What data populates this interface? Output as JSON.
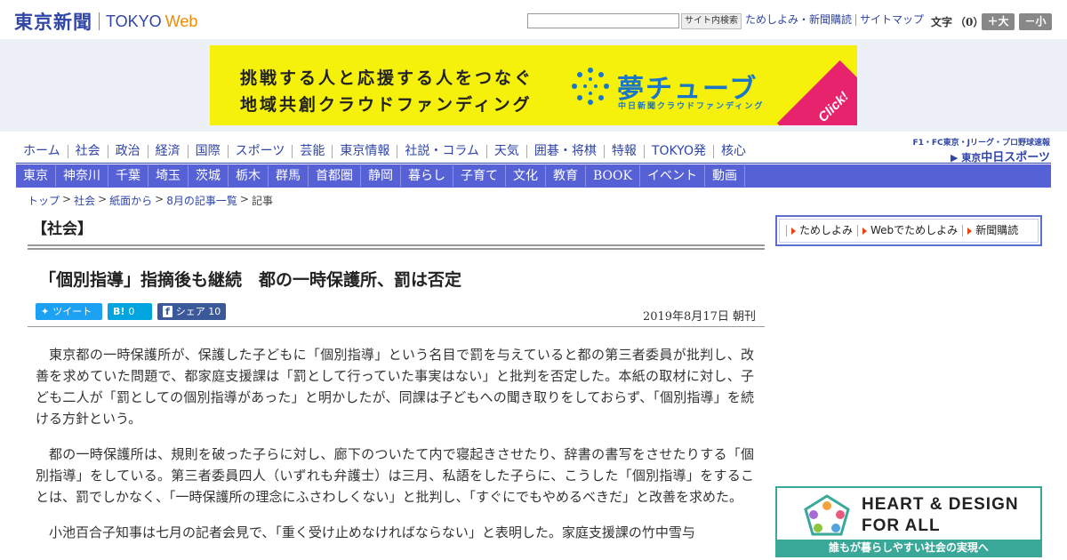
{
  "header": {
    "logo_jp": "東京新聞",
    "logo_en": "TOKYO",
    "logo_web": "Web",
    "search_button": "サイト内検索",
    "util_links": [
      "ためしよみ・新聞購読",
      "サイトマップ"
    ],
    "font_size_label": "文字",
    "font_size_count": "（0）",
    "size_up": "＋大",
    "size_down": "－小"
  },
  "banner": {
    "line1": "挑戦する人と応援する人をつなぐ",
    "line2": "地域共創クラウドファンディング",
    "brand": "夢チューブ",
    "sub": "中日新聞クラウドファンディング",
    "click": "Click!",
    "colors": {
      "background": "#f5f10a",
      "brand": "#1a76c8",
      "click": "#e8236d"
    }
  },
  "nav_primary": [
    "ホーム",
    "社会",
    "政治",
    "経済",
    "国際",
    "スポーツ",
    "芸能",
    "東京情報",
    "社説・コラム",
    "天気",
    "囲碁・将棋",
    "特報",
    "TOKYO発",
    "核心"
  ],
  "sports_link": {
    "top": "F1・FC東京・Jリーグ・プロ野球速報",
    "prefix": "東京",
    "name": "中日スポーツ"
  },
  "nav_secondary": [
    "東京",
    "神奈川",
    "千葉",
    "埼玉",
    "茨城",
    "栃木",
    "群馬",
    "首都圏",
    "静岡",
    "暮らし",
    "子育て",
    "文化",
    "教育",
    "BOOK",
    "イベント",
    "動画"
  ],
  "breadcrumb": {
    "items": [
      "トップ",
      "社会",
      "紙面から",
      "8月の記事一覧"
    ],
    "separator": ">",
    "current": "記事"
  },
  "article": {
    "section": "【社会】",
    "title": "「個別指導」指摘後も継続　都の一時保護所、罰は否定",
    "share": {
      "tweet": "ツイート",
      "hatena_icon": "B!",
      "hatena_count": "0",
      "fb_icon": "f",
      "fb_label": "シェア",
      "fb_count": "10"
    },
    "date": "2019年8月17日 朝刊",
    "paragraphs": [
      "東京都の一時保護所が、保護した子どもに「個別指導」という名目で罰を与えていると都の第三者委員が批判し、改善を求めていた問題で、都家庭支援課は「罰として行っていた事実はない」と批判を否定した。本紙の取材に対し、子ども二人が「罰としての個別指導があった」と明かしたが、同課は子どもへの聞き取りをしておらず、「個別指導」を続ける方針という。",
      "都の一時保護所は、規則を破った子らに対し、廊下のついたて内で寝起きさせたり、辞書の書写をさせたりする「個別指導」をしている。第三者委員四人（いずれも弁護士）は三月、私語をした子らに、こうした「個別指導」をすることは、罰でしかなく、「一時保護所の理念にふさわしくない」と批判し、「すぐにでもやめるべきだ」と改善を求めた。",
      "小池百合子知事は七月の記者会見で、「重く受け止めなければならない」と表明した。家庭支援課の竹中雪与"
    ]
  },
  "sidebar": {
    "subscribe_links": [
      "ためしよみ",
      "Webでためしよみ",
      "新聞購読"
    ],
    "hd_banner": {
      "title1": "HEART & DESIGN",
      "title2": "FOR ALL",
      "footer": "誰もが暮らしやすい社会の実現へ"
    }
  }
}
